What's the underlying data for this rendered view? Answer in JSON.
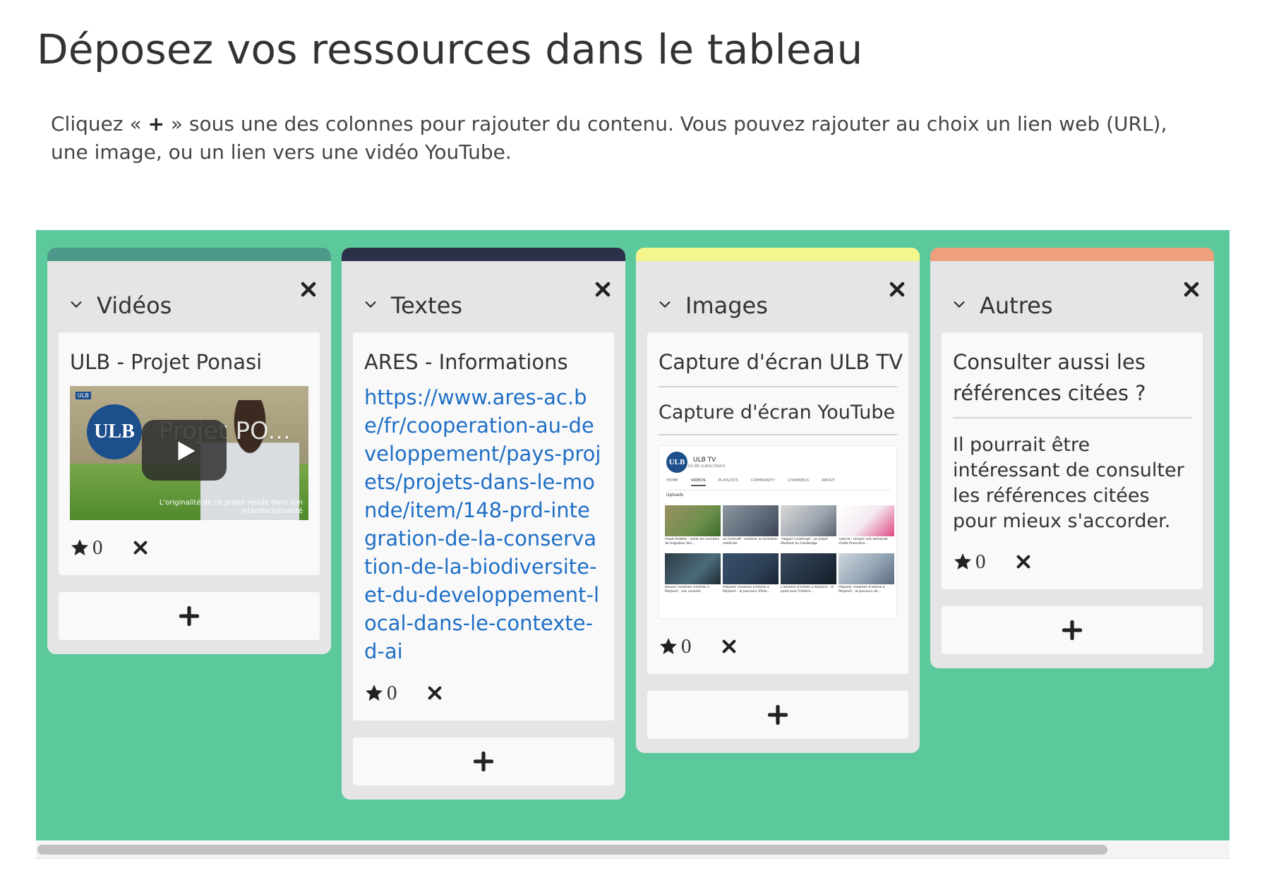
{
  "page": {
    "title": "Déposez vos ressources dans le tableau",
    "intro_before": "Cliquez « ",
    "intro_plus": "+",
    "intro_after": " » sous une des colonnes pour rajouter du contenu. Vous pouvez rajouter au choix un lien web (URL), une image, ou un lien vers une vidéo YouTube."
  },
  "colors": {
    "board": "#5bc99c",
    "column_bg": "#e5e5e5",
    "card_bg": "#f9f9f9",
    "bar_videos": "#4d9a8a",
    "bar_textes": "#2c3049",
    "bar_images": "#f5f58e",
    "bar_autres": "#ee9f7b",
    "link": "#1f6fc6"
  },
  "columns": [
    {
      "title": "Vidéos",
      "card": {
        "title": "ULB - Projet Ponasi",
        "thumbnail": {
          "logo": "ULB",
          "video_title": "Projet PO...",
          "caption": "L'originalité de ce projet réside dans son interdisciplinarité"
        },
        "rating": "0"
      }
    },
    {
      "title": "Textes",
      "card": {
        "title": "ARES - Informations",
        "link": "https://www.ares-ac.be/fr/cooperation-au-developpement/pays-projets/projets-dans-le-monde/item/148-prd-integration-de-la-conservation-de-la-biodiversite-et-du-developpement-local-dans-le-contexte-d-ai",
        "rating": "0"
      }
    },
    {
      "title": "Images",
      "card": {
        "title": "Capture d'écran ULB TV",
        "description": "Capture d'écran YouTube",
        "screenshot": {
          "avatar": "ULB",
          "channel": "ULB TV",
          "subscribers": "16.9K subscribers",
          "tabs": [
            "HOME",
            "VIDEOS",
            "PLAYLISTS",
            "COMMUNITY",
            "CHANNELS",
            "ABOUT"
          ],
          "uploads": "Uploads",
          "videos": [
            "Projet PONASI : Gérer les corridors de migration des...",
            "La FOSFOM : Soutenir la formation médicale",
            "\"Pepper Challenge\", un projet étudiant au Cambodge",
            "Tutoriel : remplir une demande d'aide financière...",
            "Réussir l'examen d'entrée à Polytech : nos conseils",
            "Préparer l'examen d'entrée à Polytech : le parcours d'Ede...",
            "L'examen d'entrée à Polytech : le point avec Frédéric...",
            "Préparer l'examen d'entrée à Polytech : le parcours de..."
          ]
        },
        "rating": "0"
      }
    },
    {
      "title": "Autres",
      "card": {
        "title": "Consulter aussi les références citées ?",
        "body": "Il pourrait être intéressant de consulter les références citées pour mieux s'accorder.",
        "rating": "0"
      }
    }
  ]
}
